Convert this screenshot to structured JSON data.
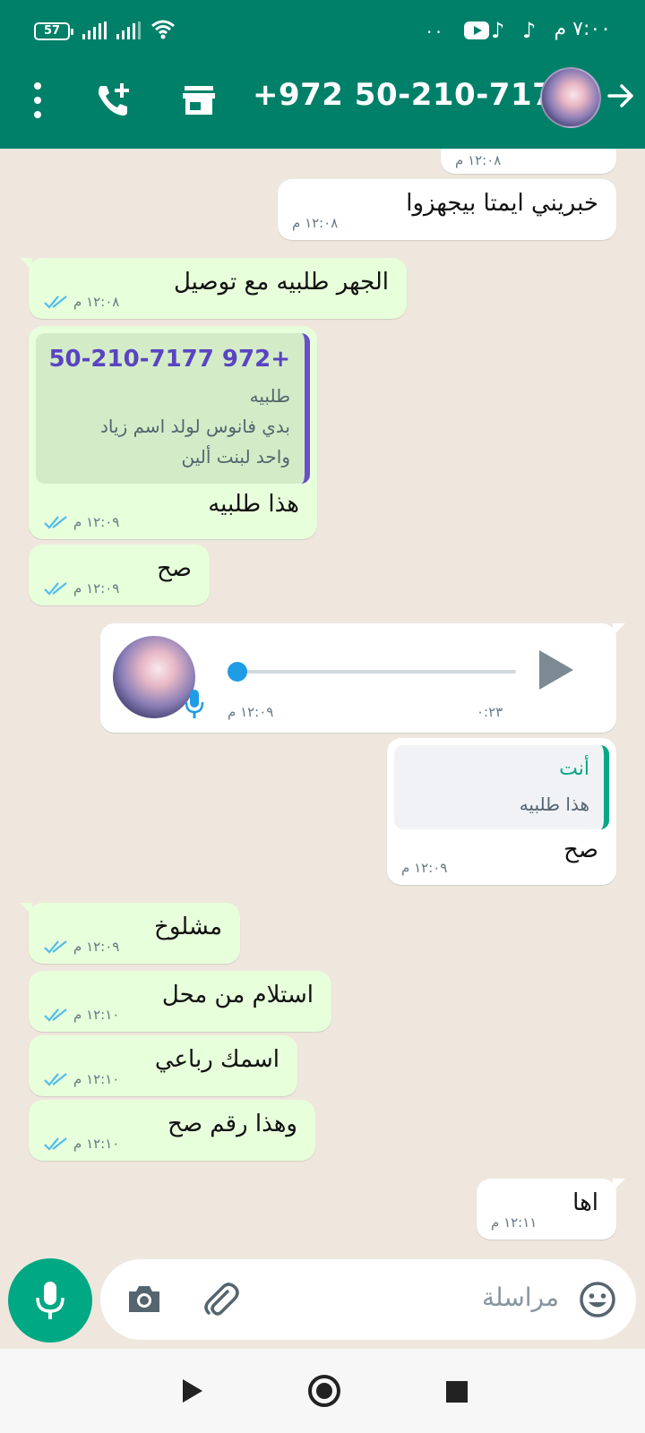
{
  "status_bar": {
    "battery": "57",
    "dots": "··",
    "time": "٧:٠٠ م"
  },
  "header": {
    "contact": "+972 50-210-7177"
  },
  "messages": [
    {
      "text": "",
      "time": "١٢:٠٨ م",
      "direction": "outgoing"
    },
    {
      "text": "خبريني ايمتا بيجهزوا",
      "time": "١٢:٠٨ م",
      "direction": "outgoing"
    },
    {
      "text": "الجهر طلبيه مع توصيل",
      "time": "١٢:٠٨ م",
      "direction": "incoming",
      "read": true
    },
    {
      "text": "هذا طلبيه",
      "time": "١٢:٠٩ م",
      "direction": "incoming",
      "read": true,
      "quote": {
        "author": "+972 50-210-7177",
        "line1": "طلبيه",
        "line2": "بدي فانوس  لولد  اسم زياد",
        "line3": "واحد لبنت ألين"
      }
    },
    {
      "text": "صح",
      "time": "١٢:٠٩ م",
      "direction": "incoming",
      "read": true
    },
    {
      "type": "voice",
      "duration": "٠:٢٣",
      "time": "١٢:٠٩ م",
      "direction": "outgoing",
      "progress": 0
    },
    {
      "text": "صح",
      "time": "١٢:٠٩ م",
      "direction": "outgoing",
      "quote": {
        "author": "أنت",
        "line1": "هذا طلبيه"
      }
    },
    {
      "text": "مشلوخ",
      "time": "١٢:٠٩ م",
      "direction": "incoming",
      "read": true
    },
    {
      "text": "استلام من محل",
      "time": "١٢:١٠ م",
      "direction": "incoming",
      "read": true
    },
    {
      "text": "اسمك رباعي",
      "time": "١٢:١٠ م",
      "direction": "incoming",
      "read": true
    },
    {
      "text": "وهذا رقم صح",
      "time": "١٢:١٠ م",
      "direction": "incoming",
      "read": true
    },
    {
      "text": "اها",
      "time": "١٢:١١ م",
      "direction": "outgoing"
    }
  ],
  "input": {
    "placeholder": "مراسلة"
  },
  "colors": {
    "header": "#008069",
    "incoming_bubble": "#e7ffdb",
    "outgoing_bubble": "#ffffff",
    "accent": "#00a884",
    "read_ticks": "#53bdeb"
  },
  "icons": [
    "battery-icon",
    "signal-icon",
    "wifi-icon",
    "youtube-icon",
    "tiktok-icon",
    "more-options-icon",
    "add-call-icon",
    "store-icon",
    "avatar",
    "back-arrow-icon",
    "read-ticks-icon",
    "play-icon",
    "mic-icon",
    "camera-icon",
    "attach-icon",
    "emoji-icon",
    "nav-back-icon",
    "nav-home-icon",
    "nav-recents-icon"
  ]
}
